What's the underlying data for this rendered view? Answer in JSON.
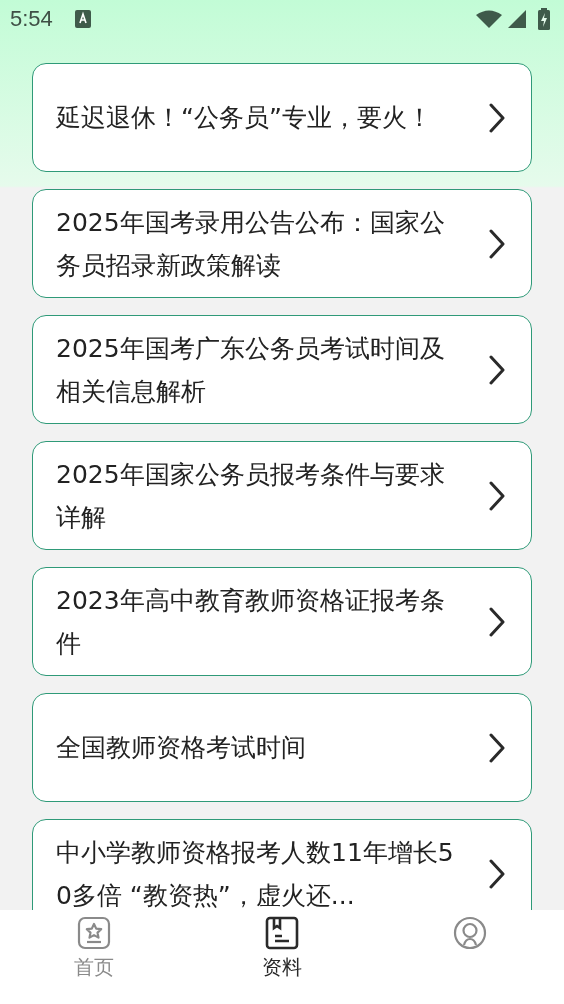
{
  "status_bar": {
    "time": "5:54"
  },
  "articles": [
    {
      "title": "延迟退休！“公务员”专业，要火！"
    },
    {
      "title": "2025年国考录用公告公布：国家公务员招录新政策解读"
    },
    {
      "title": "2025年国考广东公务员考试时间及相关信息解析"
    },
    {
      "title": "2025年国家公务员报考条件与要求详解"
    },
    {
      "title": "2023年高中教育教师资格证报考条件"
    },
    {
      "title": "全国教师资格考试时间"
    },
    {
      "title": "中小学教师资格报考人数11年增长50多倍 “教资热”，虚火还..."
    }
  ],
  "bottom_nav": [
    {
      "kind": "home",
      "label": "首页",
      "selected": false
    },
    {
      "kind": "docs",
      "label": "资料",
      "selected": true
    },
    {
      "kind": "profile",
      "selected": false
    }
  ]
}
